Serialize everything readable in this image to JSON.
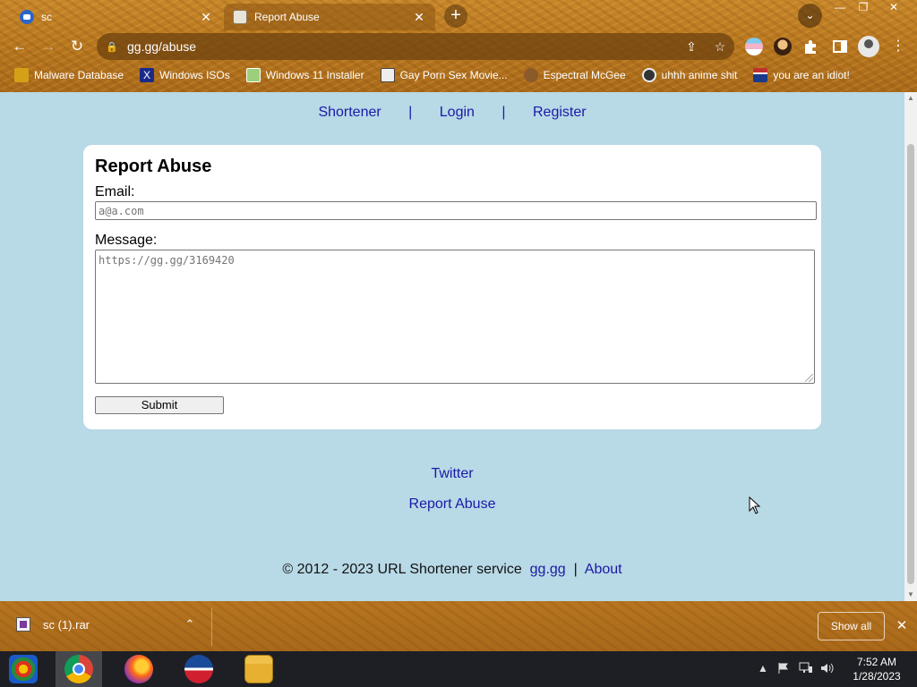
{
  "browser": {
    "tabs": [
      {
        "title": "sc",
        "close": "✕"
      },
      {
        "title": "Report Abuse",
        "close": "✕"
      }
    ],
    "new_tab": "+",
    "tab_search": "⌄",
    "window_controls": {
      "minimize": "—",
      "restore": "❐",
      "close": "✕"
    },
    "nav": {
      "back": "←",
      "forward": "→",
      "reload": "↻"
    },
    "url": "gg.gg/abuse",
    "lock": "🔒",
    "share_icon": "⇪",
    "star_icon": "☆",
    "menu": "⋮",
    "bookmarks": [
      {
        "label": "Malware Database",
        "icon": "folder-icon",
        "color": "#d4a017"
      },
      {
        "label": "Windows ISOs",
        "icon": "x-icon",
        "color": "#1b2a8a"
      },
      {
        "label": "Windows 11 Installer",
        "icon": "image-icon",
        "color": "#9ccf7a"
      },
      {
        "label": "Gay Porn Sex Movie...",
        "icon": "site-icon",
        "color": "#eeeeee"
      },
      {
        "label": "Espectral McGee",
        "icon": "avatar-icon",
        "color": "#8b5a2b"
      },
      {
        "label": "uhhh anime shit",
        "icon": "anime-icon",
        "color": "#333333"
      },
      {
        "label": "you are an idiot!",
        "icon": "flag-icon",
        "color": "#c03030"
      }
    ]
  },
  "page": {
    "nav": {
      "shortener": "Shortener",
      "sep": "|",
      "login": "Login",
      "register": "Register"
    },
    "form": {
      "title": "Report Abuse",
      "email_label": "Email:",
      "email_placeholder": "a@a.com",
      "message_label": "Message:",
      "message_placeholder": "https://gg.gg/3169420",
      "submit": "Submit"
    },
    "footer": {
      "twitter": "Twitter",
      "report_abuse": "Report Abuse",
      "copyright": "© 2012 - 2023 URL Shortener service",
      "site_link": "gg.gg",
      "sep": "|",
      "about": "About"
    }
  },
  "download_bar": {
    "file": "sc (1).rar",
    "chevron": "⌃",
    "show_all": "Show all",
    "close": "✕"
  },
  "taskbar": {
    "tray_arrow": "▲",
    "time": "7:52 AM",
    "date": "1/28/2023"
  }
}
